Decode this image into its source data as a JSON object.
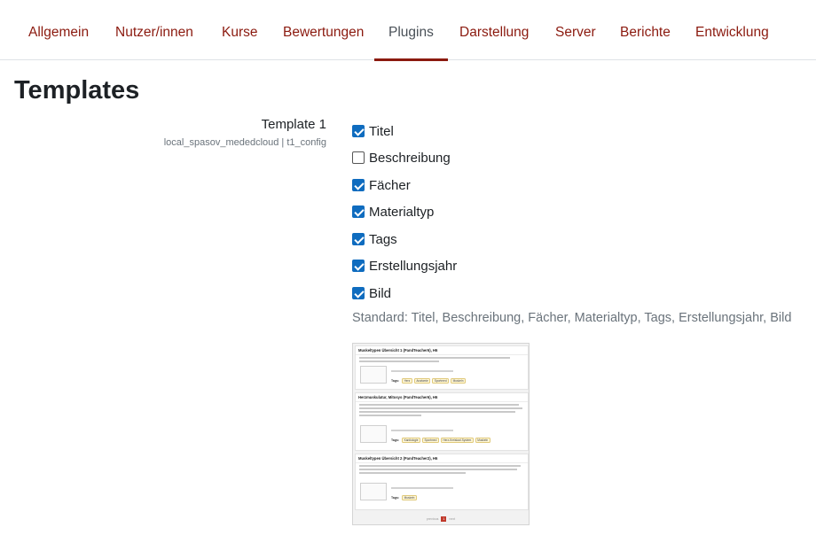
{
  "nav": {
    "tabs": [
      {
        "label": "Allgemein"
      },
      {
        "label": "Nutzer/innen"
      },
      {
        "label": "Kurse"
      },
      {
        "label": "Bewertungen"
      },
      {
        "label": "Plugins"
      },
      {
        "label": "Darstellung"
      },
      {
        "label": "Server"
      },
      {
        "label": "Berichte"
      },
      {
        "label": "Entwicklung"
      }
    ],
    "active_tab": "Plugins",
    "link_color": "#8b1a0f"
  },
  "page": {
    "title": "Templates"
  },
  "setting": {
    "name": "Template 1",
    "id": "local_spasov_mededcloud | t1_config",
    "options": [
      {
        "label": "Titel",
        "checked": true
      },
      {
        "label": "Beschreibung",
        "checked": false
      },
      {
        "label": "Fächer",
        "checked": true
      },
      {
        "label": "Materialtyp",
        "checked": true
      },
      {
        "label": "Tags",
        "checked": true
      },
      {
        "label": "Erstellungsjahr",
        "checked": true
      },
      {
        "label": "Bild",
        "checked": true
      }
    ],
    "default_text": "Standard: Titel, Beschreibung, Fächer, Materialtyp, Tags, Erstellungsjahr, Bild",
    "checkbox_color": "#0f6cbf"
  },
  "preview": {
    "cards": [
      {
        "title": "Muskeltypen Übersicht 1 (PandTeacher6), H6",
        "tags": [
          "Herz",
          "Anatomie",
          "Sportmed",
          "Muskeln"
        ]
      },
      {
        "title": "Herzmuskulatur, Mitosys (PandTeacher6), H6",
        "tags": [
          "Kardiologie",
          "Sportmed",
          "Herz-Kreislauf-System",
          "Muskeln"
        ]
      },
      {
        "title": "Muskeltypen Übersicht 2 (PandTeacher2), H6",
        "tags": [
          "Muskeln"
        ]
      }
    ],
    "tags_label": "Tags:",
    "pager": {
      "prev": "previous",
      "current": "1",
      "next": "next"
    }
  }
}
